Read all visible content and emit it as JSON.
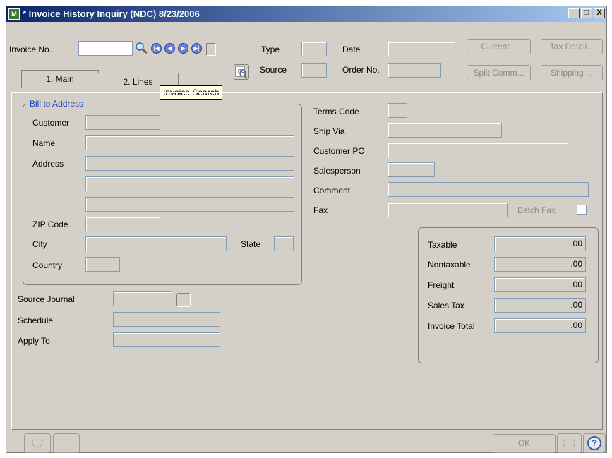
{
  "window": {
    "title": "* Invoice History Inquiry (NDC) 8/23/2006",
    "controls": [
      "_",
      "□",
      "X"
    ]
  },
  "header": {
    "invoice_no_label": "Invoice No.",
    "invoice_no_value": "",
    "type_label": "Type",
    "date_label": "Date",
    "source_label": "Source",
    "order_no_label": "Order No.",
    "current_button": "Current...",
    "tax_detail_button": "Tax Detail...",
    "split_comm_button": "Split Comm...",
    "shipping_button": "Shipping ...",
    "tooltip": "Invoice Search"
  },
  "tabs": [
    {
      "label": "1. Main",
      "active": true
    },
    {
      "label": "2. Lines",
      "active": false
    }
  ],
  "bill_to": {
    "group_title": "Bill to Address",
    "customer_label": "Customer",
    "name_label": "Name",
    "address_label": "Address",
    "zip_label": "ZIP Code",
    "city_label": "City",
    "state_label": "State",
    "country_label": "Country"
  },
  "right_fields": {
    "terms_code_label": "Terms Code",
    "ship_via_label": "Ship Via",
    "customer_po_label": "Customer PO",
    "salesperson_label": "Salesperson",
    "comment_label": "Comment",
    "fax_label": "Fax",
    "batch_fax_label": "Batch Fax"
  },
  "lower_left": {
    "source_journal_label": "Source Journal",
    "schedule_label": "Schedule",
    "apply_to_label": "Apply To"
  },
  "totals": [
    {
      "label": "Taxable",
      "value": ".00"
    },
    {
      "label": "Nontaxable",
      "value": ".00"
    },
    {
      "label": "Freight",
      "value": ".00"
    },
    {
      "label": "Sales Tax",
      "value": ".00"
    },
    {
      "label": "Invoice Total",
      "value": ".00"
    }
  ],
  "footer": {
    "ok_button": "OK",
    "help_icon": "?"
  }
}
